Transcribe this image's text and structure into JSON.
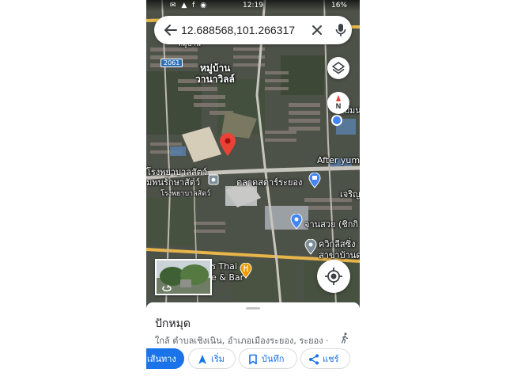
{
  "status_bar": {
    "time": "12:19",
    "battery": "16%",
    "left_icons": "✉ ▲ f ◉"
  },
  "search": {
    "query": "12.688568,101.266317",
    "back_icon": "back-arrow-icon",
    "clear_icon": "close-icon",
    "mic_icon": "mic-icon"
  },
  "map": {
    "road_shield": "2061",
    "labels": {
      "top_cut": "หมู่บ้าน",
      "village_1": "หมู่บ้าน",
      "village_2": "วานาวิลล์",
      "right_cut": "ปั้มน",
      "hospital_1": "โรงพยาบาลสัตว์",
      "hospital_2": "มพนรักษาสัตว์",
      "hospital_3": "โรงพยาบาลสัตว์",
      "market": "ตลาดสตาร์ระยอง",
      "after_yum": "After yum",
      "right_cut_2": "เจริญ",
      "bank": "จานสวย (ชิกกิ",
      "clinic_1": "ควิกลีสซิ่ง",
      "clinic_2": "สาขาบ้านดรร",
      "restaurant_1": "ร Thai",
      "restaurant_2": "e & Bar"
    },
    "accent": "#1a73e8",
    "pin_color": "#ea4335"
  },
  "compass": {
    "letter": "N"
  },
  "place": {
    "title": "ปักหมุด",
    "subtitle": "ใกล้ ตำบลเชิงเนิน, อำเภอเมืองระยอง, ระยอง ·",
    "walk_icon": "walk-icon"
  },
  "actions": {
    "directions": "เส้นทาง",
    "start": "เริ่ม",
    "save": "บันทึก",
    "share": "แชร์"
  }
}
